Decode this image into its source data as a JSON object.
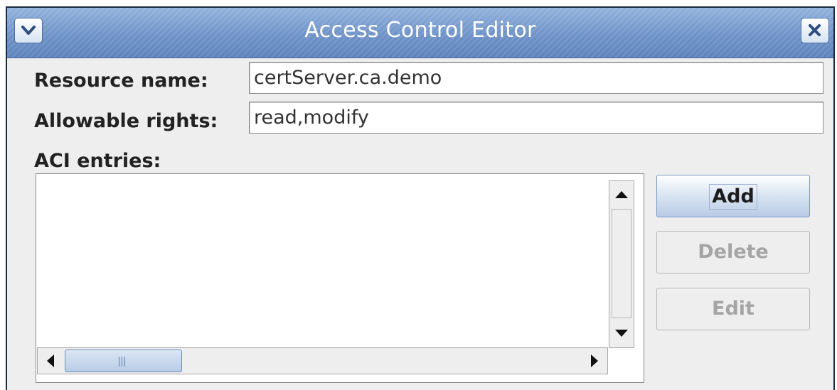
{
  "window": {
    "title": "Access Control Editor"
  },
  "form": {
    "resource_name_label": "Resource name:",
    "resource_name_value": "certServer.ca.demo",
    "allowable_rights_label": "Allowable rights:",
    "allowable_rights_value": "read,modify",
    "aci_entries_label": "ACI entries:"
  },
  "aci_entries": {
    "items": []
  },
  "buttons": {
    "add_label": "Add",
    "delete_label": "Delete",
    "edit_label": "Edit",
    "add_enabled": true,
    "delete_enabled": false,
    "edit_enabled": false
  },
  "icons": {
    "window_menu": "chevron-down-icon",
    "window_close": "close-icon",
    "scroll_up": "triangle-up-icon",
    "scroll_down": "triangle-down-icon",
    "scroll_left": "triangle-left-icon",
    "scroll_right": "triangle-right-icon"
  },
  "colors": {
    "titlebar": "#6f93c8",
    "background": "#eeeeee",
    "accent": "#b8cbe5"
  }
}
